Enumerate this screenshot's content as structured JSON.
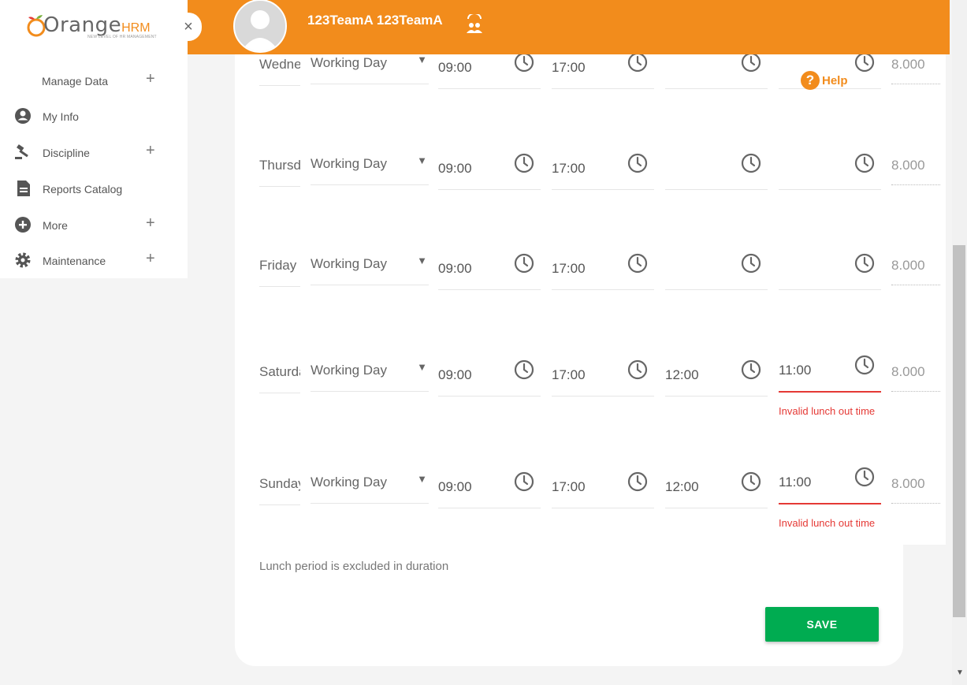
{
  "header": {
    "username": "123TeamA 123TeamA",
    "avatar_icon": "user-avatar",
    "team_icon": "team-switch-icon",
    "color": "#f28c1c"
  },
  "sidebar": {
    "logo_text": "Orange",
    "logo_hrm": "HRM",
    "logo_tagline": "NEW LEVEL OF HR MANAGEMENT",
    "close_icon": "×",
    "items": [
      {
        "label": "Manage Data",
        "icon": "",
        "expandable": "+"
      },
      {
        "label": "My Info",
        "icon": "user-circle-icon",
        "expandable": ""
      },
      {
        "label": "Discipline",
        "icon": "gavel-icon",
        "expandable": "+"
      },
      {
        "label": "Reports Catalog",
        "icon": "document-icon",
        "expandable": ""
      },
      {
        "label": "More",
        "icon": "plus-circle-icon",
        "expandable": "+"
      },
      {
        "label": "Maintenance",
        "icon": "gear-icon",
        "expandable": "+"
      }
    ]
  },
  "help": {
    "label": "Help",
    "icon": "?"
  },
  "schedule": {
    "rows": [
      {
        "day": "Wednesday",
        "type": "Working Day",
        "start": "09:00",
        "end": "17:00",
        "lunch_in": "",
        "lunch_out": "",
        "duration": "8.000",
        "error": ""
      },
      {
        "day": "Thursday",
        "type": "Working Day",
        "start": "09:00",
        "end": "17:00",
        "lunch_in": "",
        "lunch_out": "",
        "duration": "8.000",
        "error": ""
      },
      {
        "day": "Friday",
        "type": "Working Day",
        "start": "09:00",
        "end": "17:00",
        "lunch_in": "",
        "lunch_out": "",
        "duration": "8.000",
        "error": ""
      },
      {
        "day": "Saturday",
        "type": "Working Day",
        "start": "09:00",
        "end": "17:00",
        "lunch_in": "12:00",
        "lunch_out": "11:00",
        "duration": "8.000",
        "error": "Invalid lunch out time"
      },
      {
        "day": "Sunday",
        "type": "Working Day",
        "start": "09:00",
        "end": "17:00",
        "lunch_in": "12:00",
        "lunch_out": "11:00",
        "duration": "8.000",
        "error": "Invalid lunch out time"
      }
    ],
    "note": "Lunch period is excluded in duration",
    "save_label": "SAVE",
    "error_color": "#e53935",
    "save_color": "#00ac51"
  }
}
